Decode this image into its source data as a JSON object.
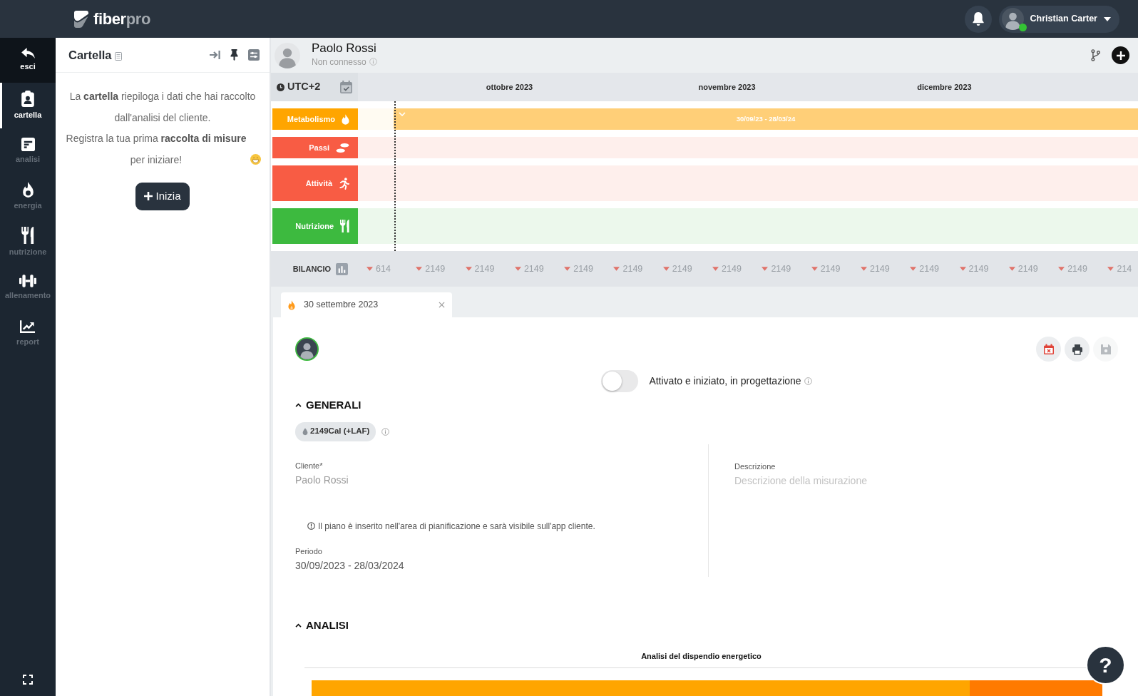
{
  "topbar": {
    "logo": {
      "text": "fiber",
      "accent": "pro"
    },
    "user": {
      "name": "Christian Carter",
      "online": true
    }
  },
  "nav": {
    "exit": {
      "label": "esci"
    },
    "items": [
      {
        "label": "cartella",
        "selected": true
      },
      {
        "label": "analisi",
        "selected": false
      },
      {
        "label": "energia",
        "selected": false
      },
      {
        "label": "nutrizione",
        "selected": false
      },
      {
        "label": "allenamento",
        "selected": false
      },
      {
        "label": "report",
        "selected": false
      }
    ]
  },
  "panel": {
    "title": "Cartella",
    "paragraphs": [
      "La **cartella** riepiloga i dati che hai raccolto dall'analisi del cliente.",
      "Registra la tua prima **raccolta di misure** per iniziare!"
    ],
    "button": "Inizia"
  },
  "patient": {
    "name": "Paolo Rossi",
    "status": "Non connesso"
  },
  "timeline": {
    "timezone": "UTC+2",
    "months": [
      "ottobre 2023",
      "novembre 2023",
      "dicembre 2023"
    ],
    "rows": [
      {
        "label": "Metabolismo",
        "color": "#ffa500",
        "period": "30/09/23 - 28/03/24"
      },
      {
        "label": "Passi",
        "color": "#f85c44"
      },
      {
        "label": "Attività",
        "color": "#f85c44"
      },
      {
        "label": "Nutrizione",
        "color": "#3dba3f"
      }
    ],
    "balance": {
      "label": "BILANCIO",
      "values": [
        "614",
        "2149",
        "2149",
        "2149",
        "2149",
        "2149",
        "2149",
        "2149",
        "2149",
        "2149",
        "2149",
        "2149",
        "2149",
        "2149",
        "2149",
        "214"
      ]
    }
  },
  "detail": {
    "tabs": [
      {
        "label": "30 settembre 2023",
        "selected": true
      }
    ],
    "actions": [
      {
        "kind": "calendar-remove",
        "disabled": false
      },
      {
        "kind": "print",
        "disabled": false
      },
      {
        "kind": "save",
        "disabled": true
      }
    ],
    "status_toggle": {
      "label": "Attivato e iniziato, in progettazione",
      "on": false
    },
    "general": {
      "title": "GENERALI",
      "expanded": true,
      "badge": "2149Cal (+LAF)",
      "client": {
        "label": "Cliente*",
        "value": "Paolo Rossi"
      },
      "notice": "Il piano è inserito nell'area di pianificazione e sarà visibile sull'app cliente.",
      "period": {
        "label": "Periodo",
        "value": "30/09/2023 - 28/03/2024"
      },
      "description": {
        "label": "Descrizione",
        "placeholder": "Descrizione della misurazione"
      }
    },
    "analysis": {
      "title": "ANALISI",
      "expanded": true,
      "chart_title": "Analisi del dispendio energetico"
    }
  },
  "help": {
    "label": "?"
  }
}
